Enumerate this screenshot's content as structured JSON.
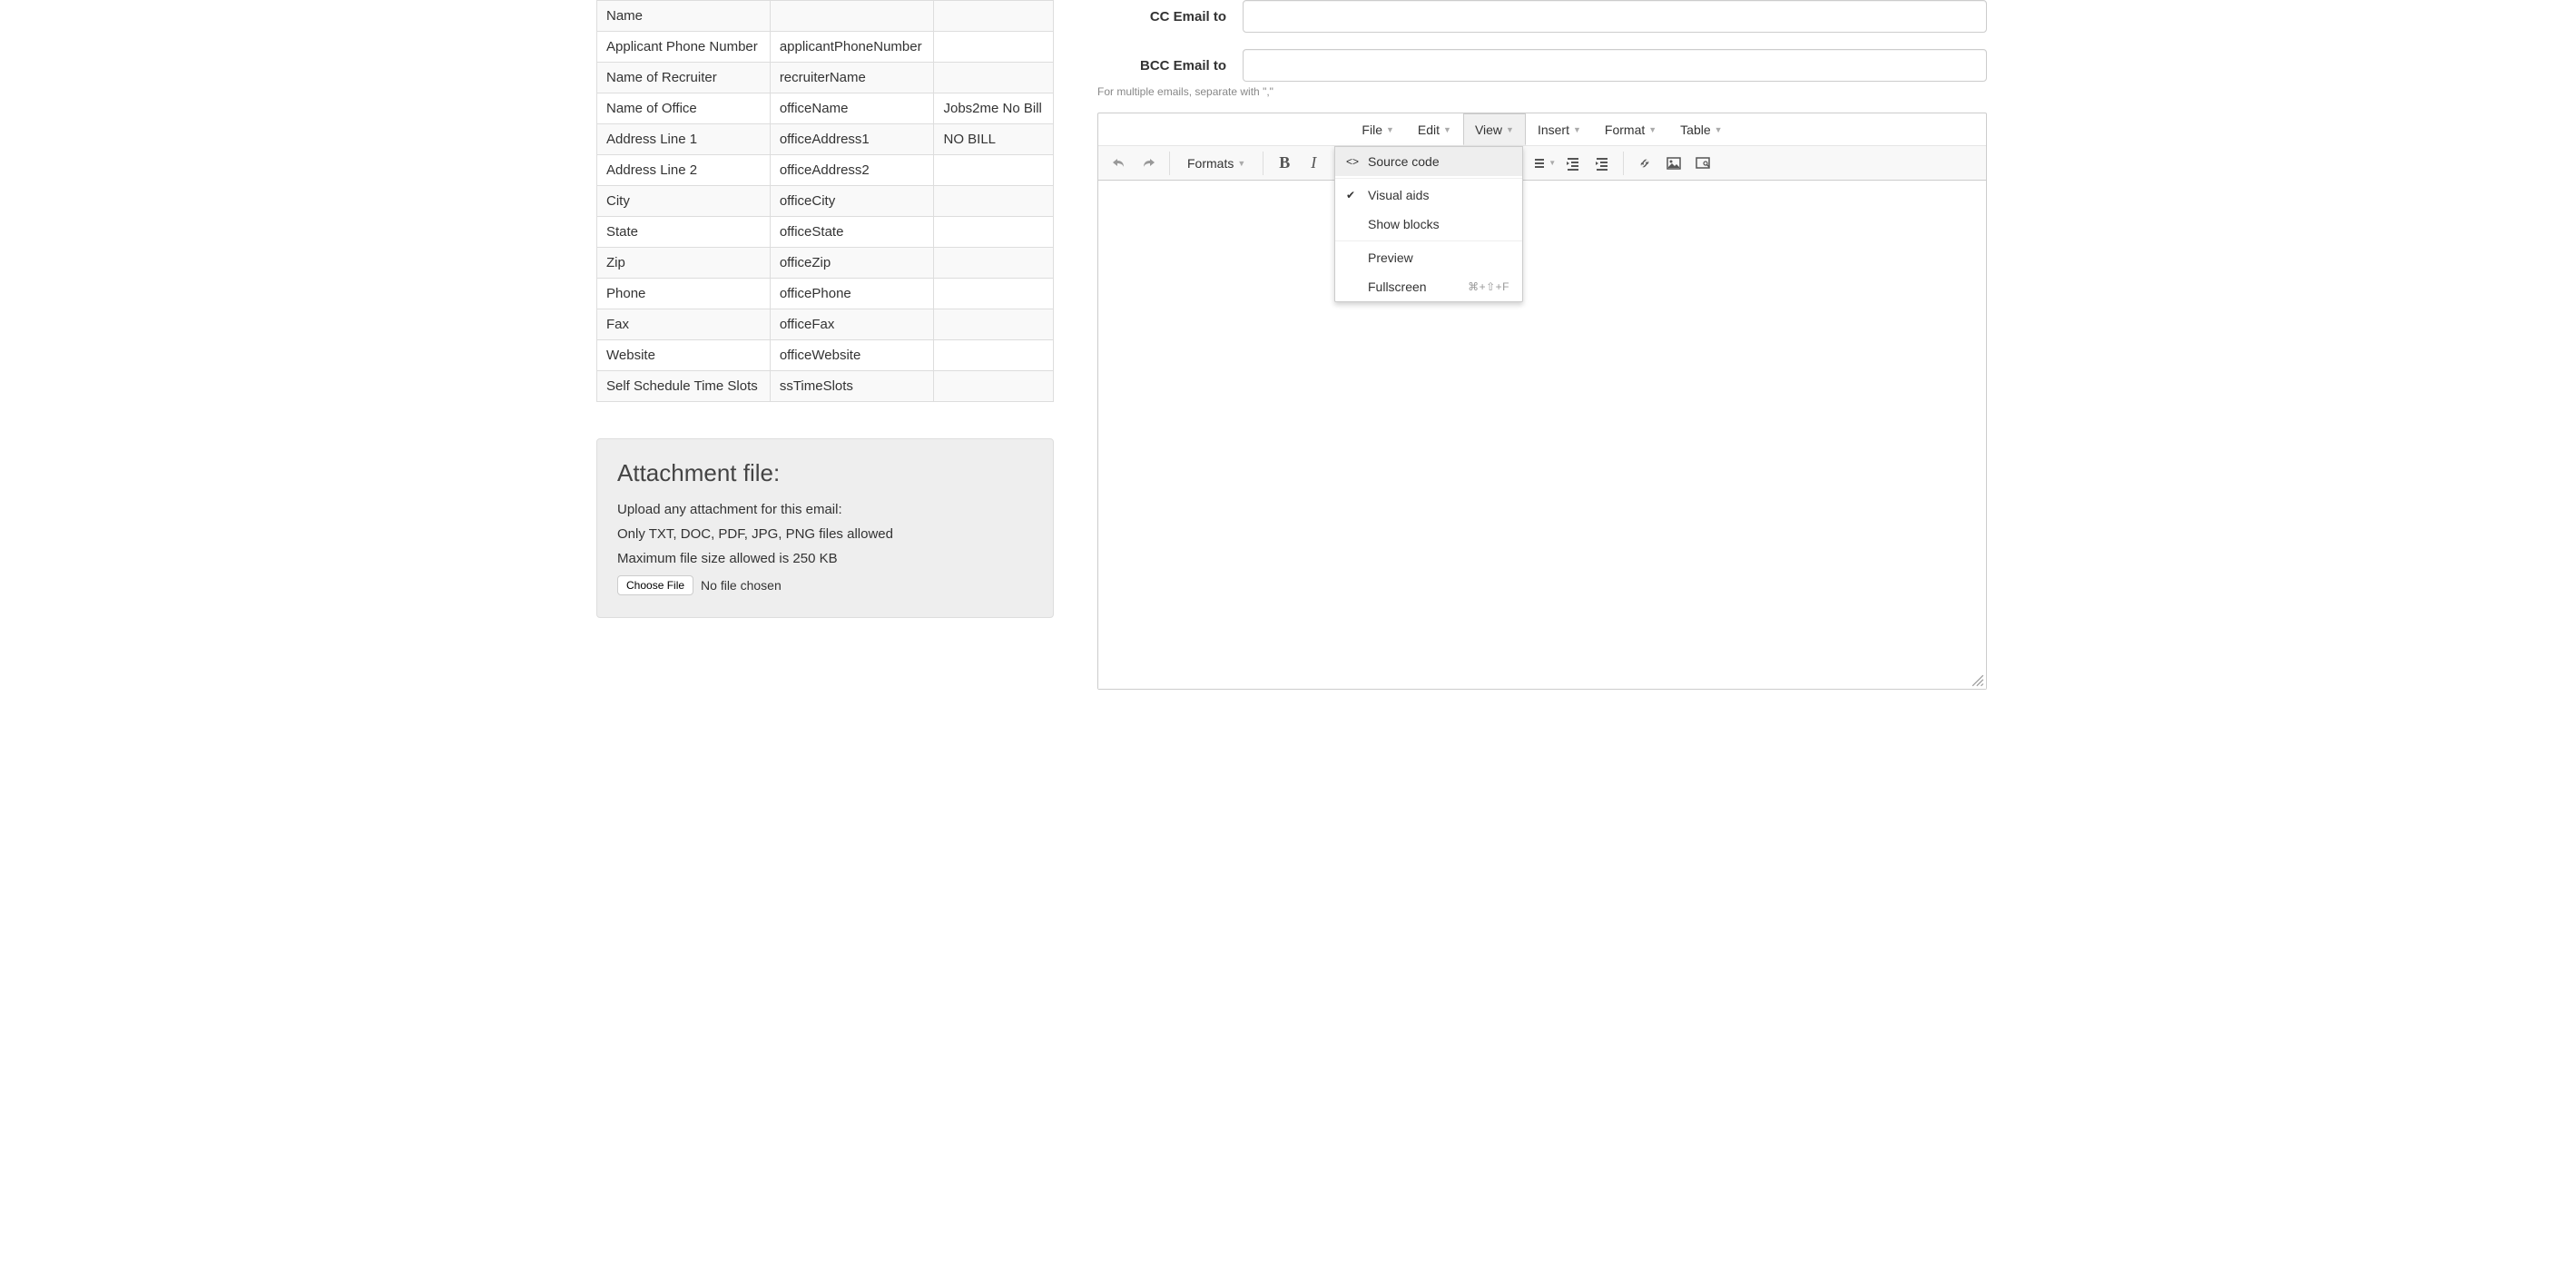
{
  "table_rows": [
    {
      "label": "Name",
      "var": "",
      "extra": ""
    },
    {
      "label": "Applicant Phone Number",
      "var": "applicantPhoneNumber",
      "extra": ""
    },
    {
      "label": "Name of Recruiter",
      "var": "recruiterName",
      "extra": ""
    },
    {
      "label": "Name of Office",
      "var": "officeName",
      "extra": "Jobs2me No Bill"
    },
    {
      "label": "Address Line 1",
      "var": "officeAddress1",
      "extra": "NO BILL"
    },
    {
      "label": "Address Line 2",
      "var": "officeAddress2",
      "extra": ""
    },
    {
      "label": "City",
      "var": "officeCity",
      "extra": ""
    },
    {
      "label": "State",
      "var": "officeState",
      "extra": ""
    },
    {
      "label": "Zip",
      "var": "officeZip",
      "extra": ""
    },
    {
      "label": "Phone",
      "var": "officePhone",
      "extra": ""
    },
    {
      "label": "Fax",
      "var": "officeFax",
      "extra": ""
    },
    {
      "label": "Website",
      "var": "officeWebsite",
      "extra": ""
    },
    {
      "label": "Self Schedule Time Slots",
      "var": "ssTimeSlots",
      "extra": ""
    }
  ],
  "attachment": {
    "title": "Attachment file:",
    "line1": "Upload any attachment for this email:",
    "line2": "Only TXT, DOC, PDF, JPG, PNG files allowed",
    "line3": "Maximum file size allowed is 250 KB",
    "choose_label": "Choose File",
    "no_file": "No file chosen"
  },
  "form": {
    "cc_label": "CC Email to",
    "bcc_label": "BCC Email to",
    "hint": "For multiple emails, separate with \",\""
  },
  "menubar": [
    "File",
    "Edit",
    "View",
    "Insert",
    "Format",
    "Table"
  ],
  "toolbar": {
    "formats_label": "Formats"
  },
  "dropdown": {
    "source_code": "Source code",
    "visual_aids": "Visual aids",
    "show_blocks": "Show blocks",
    "preview": "Preview",
    "fullscreen": "Fullscreen",
    "fullscreen_shortcut": "⌘+⇧+F"
  }
}
